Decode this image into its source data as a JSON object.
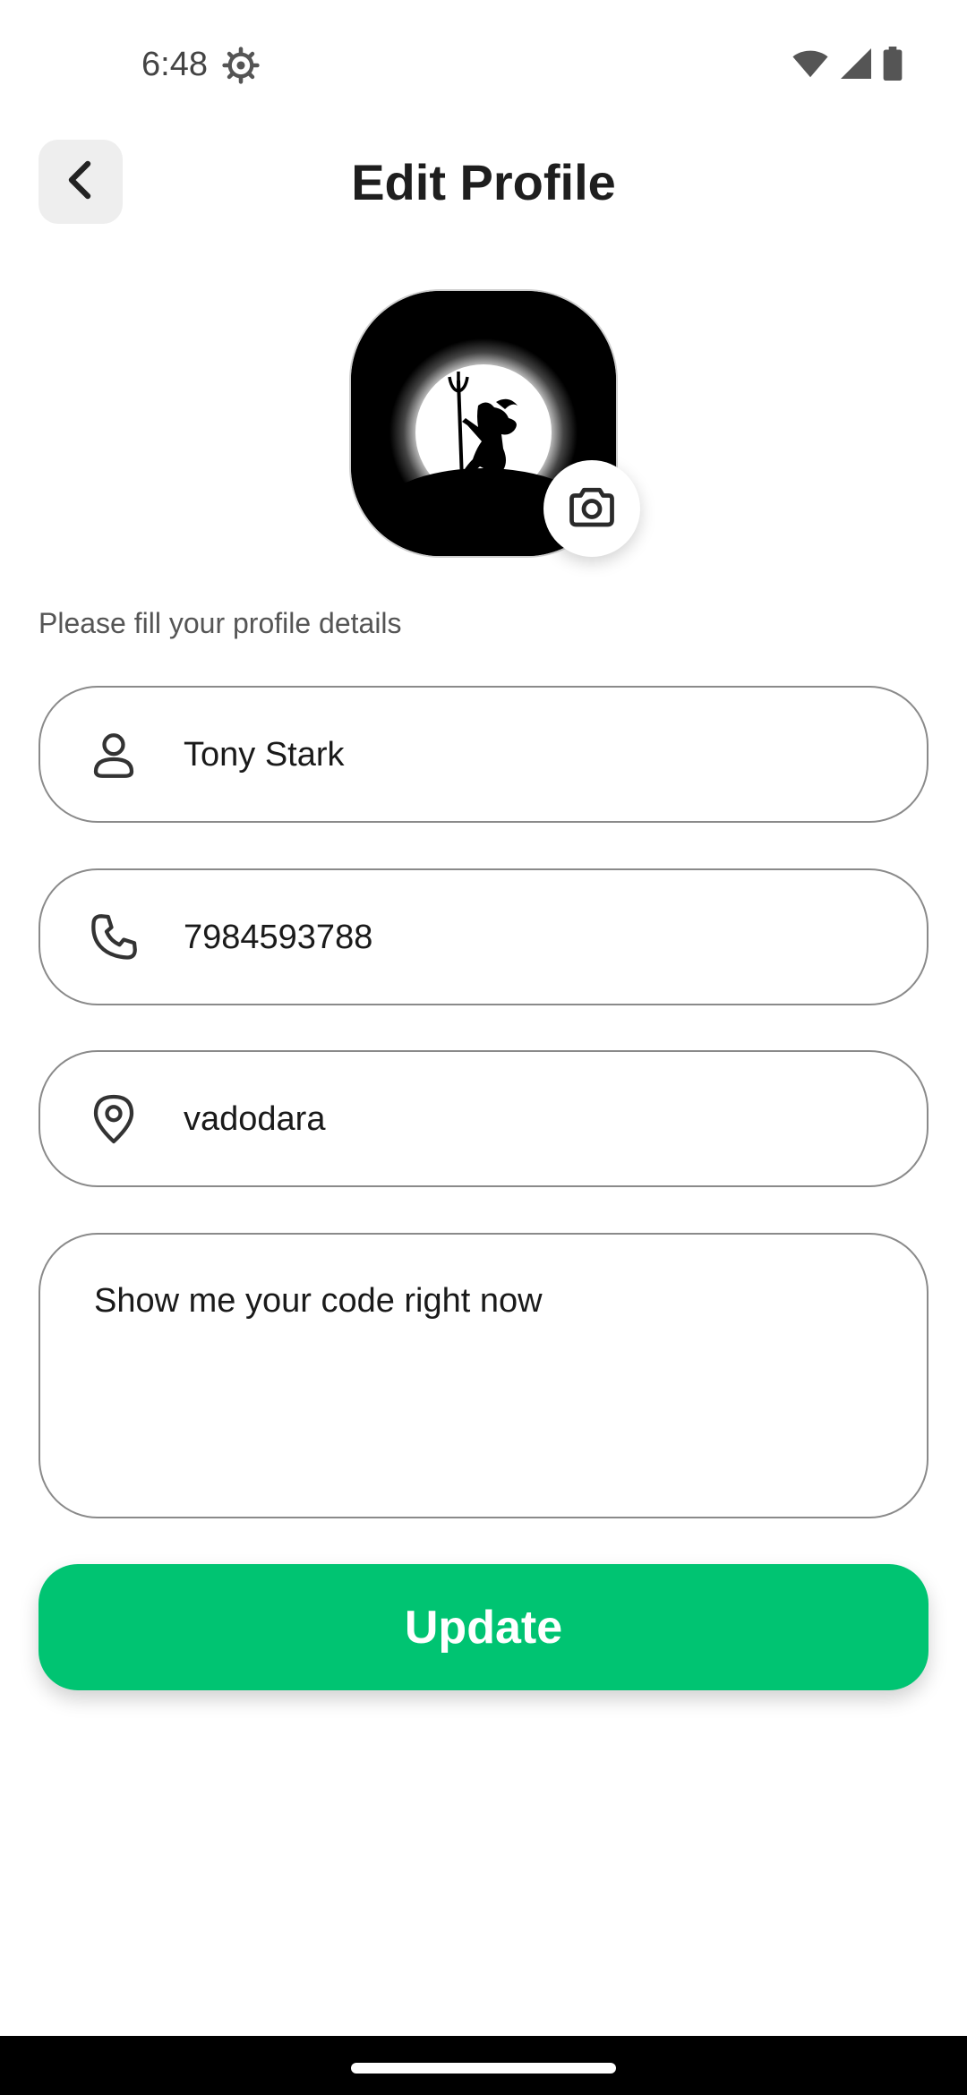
{
  "status_bar": {
    "time": "6:48",
    "icons": [
      "settings-gear-icon",
      "wifi-icon",
      "signal-icon",
      "battery-icon"
    ]
  },
  "header": {
    "back_icon": "chevron-left-icon",
    "title": "Edit Profile"
  },
  "profile": {
    "avatar": "profile-avatar",
    "camera_icon": "camera-icon"
  },
  "form": {
    "subtitle": "Please fill your profile details",
    "name": {
      "icon": "person-icon",
      "value": "Tony Stark"
    },
    "phone": {
      "icon": "phone-icon",
      "value": "7984593788"
    },
    "city": {
      "icon": "location-pin-icon",
      "value": "vadodara"
    },
    "bio": {
      "value": "Show me your code right now"
    },
    "update_label": "Update"
  },
  "colors": {
    "accent": "#00c472",
    "field_border": "#8a8a8a",
    "back_bg": "#eeeeee"
  }
}
